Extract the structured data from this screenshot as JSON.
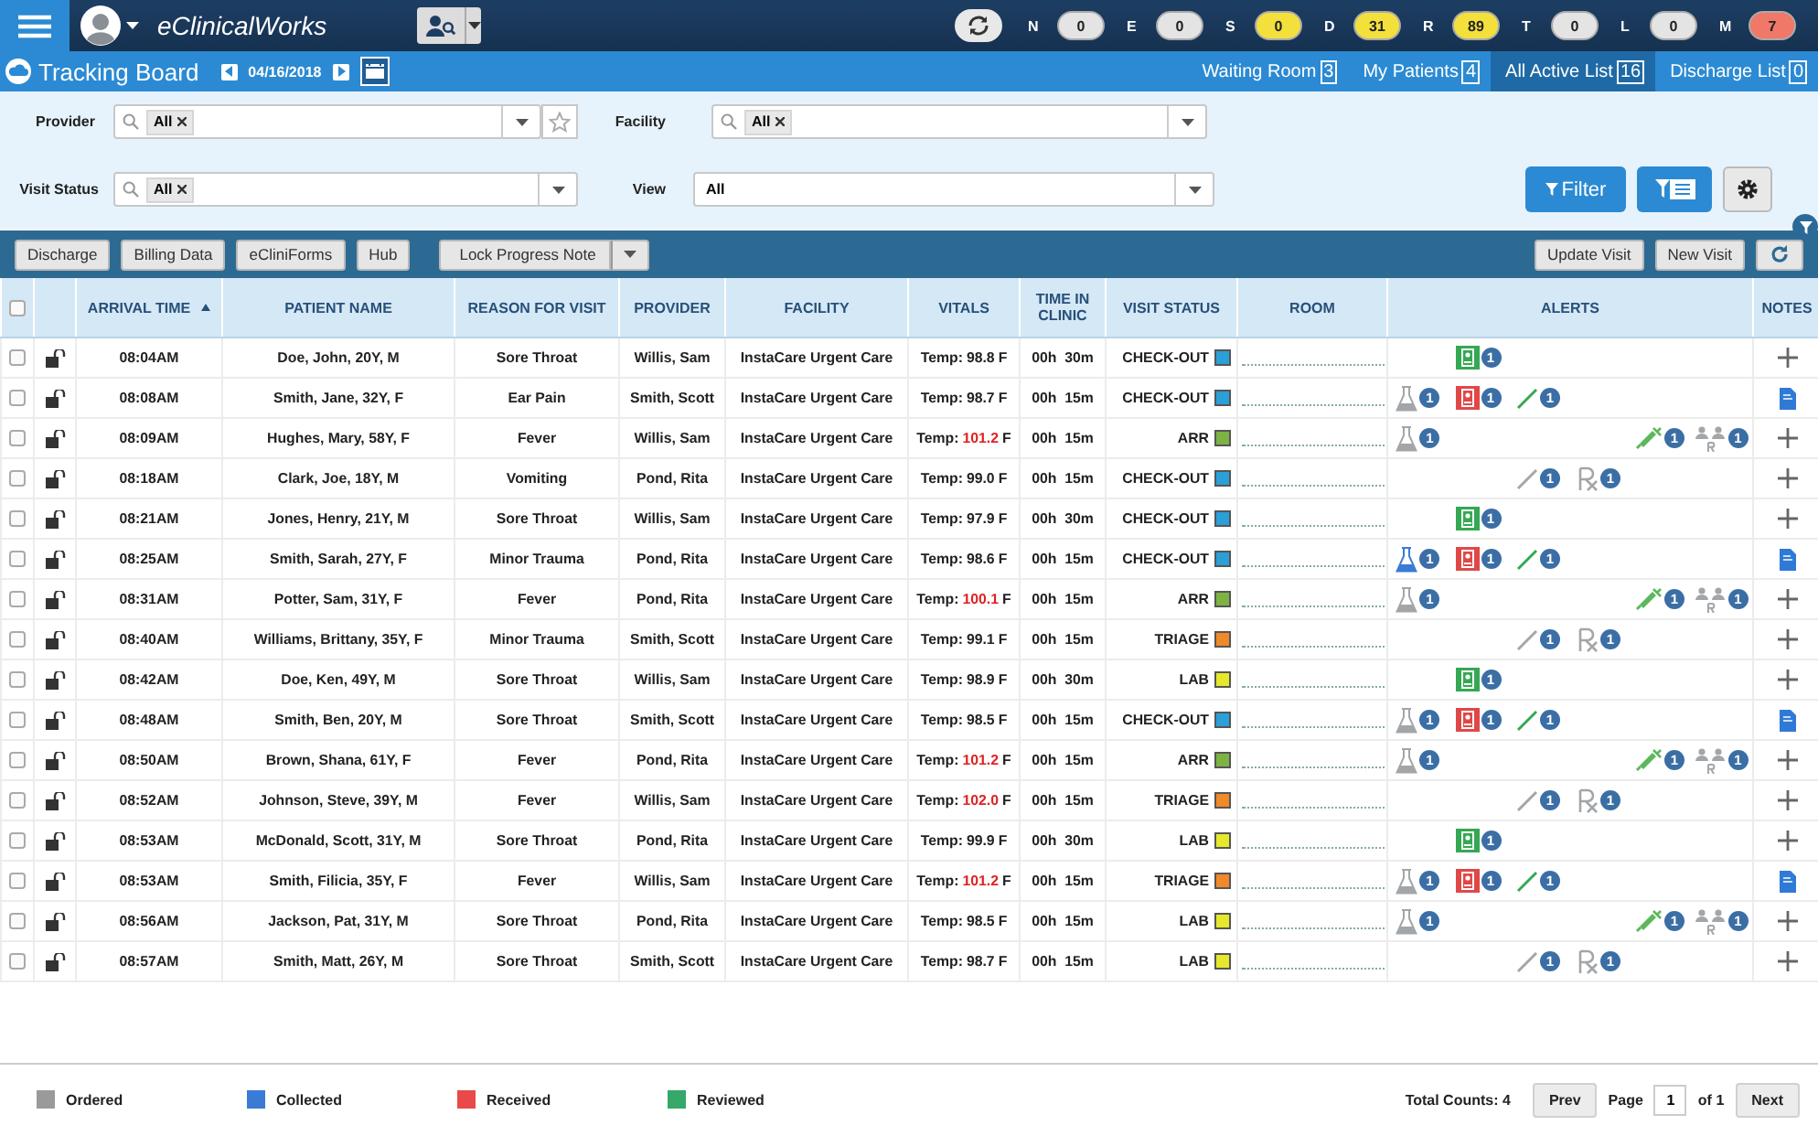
{
  "header": {
    "logo": "eClinicalWorks",
    "counters": [
      {
        "letter": "N",
        "value": "0",
        "color": "#e4e4e4"
      },
      {
        "letter": "E",
        "value": "0",
        "color": "#e4e4e4"
      },
      {
        "letter": "S",
        "value": "0",
        "color": "#f3e03c"
      },
      {
        "letter": "D",
        "value": "31",
        "color": "#f3e03c"
      },
      {
        "letter": "R",
        "value": "89",
        "color": "#f3e03c"
      },
      {
        "letter": "T",
        "value": "0",
        "color": "#e4e4e4"
      },
      {
        "letter": "L",
        "value": "0",
        "color": "#e4e4e4"
      },
      {
        "letter": "M",
        "value": "7",
        "color": "#f07868"
      }
    ]
  },
  "subbar": {
    "title": "Tracking Board",
    "date": "04/16/2018",
    "tabs": [
      {
        "label": "Waiting Room",
        "count": "3",
        "selected": false
      },
      {
        "label": "My Patients",
        "count": "4",
        "selected": false
      },
      {
        "label": "All Active List",
        "count": "16",
        "selected": true
      },
      {
        "label": "Discharge List",
        "count": "0",
        "selected": false
      }
    ]
  },
  "filters": {
    "provider": {
      "label": "Provider",
      "tags": [
        "All"
      ]
    },
    "facility": {
      "label": "Facility",
      "tags": [
        "All"
      ]
    },
    "visit_status": {
      "label": "Visit Status",
      "tags": [
        "All"
      ]
    },
    "view": {
      "label": "View",
      "value": "All"
    },
    "filter_button": "Filter"
  },
  "toolbar": {
    "left_buttons": [
      "Discharge",
      "Billing Data",
      "eCliniForms",
      "Hub"
    ],
    "split_button": "Lock Progress Note",
    "right_buttons": [
      "Update Visit",
      "New Visit"
    ]
  },
  "table": {
    "select_all_checked": false,
    "columns": [
      {
        "label": "ARRIVAL TIME",
        "sorted": true
      },
      {
        "label": "PATIENT NAME",
        "sorted": false
      },
      {
        "label": "REASON FOR VISIT",
        "sorted": false
      },
      {
        "label": "PROVIDER",
        "sorted": false
      },
      {
        "label": "FACILITY",
        "sorted": false
      },
      {
        "label": "VITALS",
        "sorted": false
      },
      {
        "label": "TIME IN CLINIC",
        "sorted": false
      },
      {
        "label": "VISIT STATUS",
        "sorted": false
      },
      {
        "label": "ROOM",
        "sorted": false
      },
      {
        "label": "ALERTS",
        "sorted": false
      },
      {
        "label": "NOTES",
        "sorted": false
      }
    ],
    "rows": [
      {
        "checked": false,
        "arrival": "08:04AM",
        "patient": "Doe, John, 20Y, M",
        "reason": "Sore Throat",
        "provider": "Willis, Sam",
        "facility": "InstaCare Urgent Care",
        "vitals": {
          "label": "Temp:",
          "value": "98.8",
          "unit": "F",
          "high": false
        },
        "time_in_clinic": "00h  30m",
        "status": {
          "text": "CHECK-OUT",
          "color": "#2a9fd8"
        },
        "alerts": [
          {
            "kind": "report",
            "color": "#35a853",
            "count": "1"
          }
        ],
        "note": {
          "kind": "add"
        }
      },
      {
        "checked": false,
        "arrival": "08:08AM",
        "patient": "Smith, Jane, 32Y, F",
        "reason": "Ear Pain",
        "provider": "Smith, Scott",
        "facility": "InstaCare Urgent Care",
        "vitals": {
          "label": "Temp:",
          "value": "98.7",
          "unit": "F",
          "high": false
        },
        "time_in_clinic": "00h  15m",
        "status": {
          "text": "CHECK-OUT",
          "color": "#2a9fd8"
        },
        "alerts": [
          {
            "kind": "lab",
            "color": "#a3a6a9",
            "count": "1"
          },
          {
            "kind": "report",
            "color": "#e04848",
            "count": "1"
          },
          {
            "kind": "procedure",
            "color": "#35a853",
            "count": "1"
          }
        ],
        "note": {
          "kind": "document"
        }
      },
      {
        "checked": false,
        "arrival": "08:09AM",
        "patient": "Hughes, Mary, 58Y, F",
        "reason": "Fever",
        "provider": "Willis, Sam",
        "facility": "InstaCare Urgent Care",
        "vitals": {
          "label": "Temp:",
          "value": "101.2",
          "unit": "F",
          "high": true
        },
        "time_in_clinic": "00h  15m",
        "status": {
          "text": "ARR",
          "color": "#7cb342"
        },
        "alerts": [
          {
            "kind": "lab",
            "color": "#a3a6a9",
            "count": "1"
          },
          {
            "kind": "injection",
            "color": "#5cb85c",
            "count": "1"
          },
          {
            "kind": "referral",
            "color": "#a3a6a9",
            "count": "1"
          }
        ],
        "note": {
          "kind": "add"
        }
      },
      {
        "checked": false,
        "arrival": "08:18AM",
        "patient": "Clark, Joe, 18Y, M",
        "reason": "Vomiting",
        "provider": "Pond, Rita",
        "facility": "InstaCare Urgent Care",
        "vitals": {
          "label": "Temp:",
          "value": "99.0",
          "unit": "F",
          "high": false
        },
        "time_in_clinic": "00h  15m",
        "status": {
          "text": "CHECK-OUT",
          "color": "#2a9fd8"
        },
        "alerts": [
          {
            "kind": "procedure",
            "color": "#a3a6a9",
            "count": "1"
          },
          {
            "kind": "rx",
            "color": "#a3a6a9",
            "count": "1"
          }
        ],
        "note": {
          "kind": "add"
        }
      },
      {
        "checked": false,
        "arrival": "08:21AM",
        "patient": "Jones, Henry, 21Y, M",
        "reason": "Sore Throat",
        "provider": "Willis, Sam",
        "facility": "InstaCare Urgent Care",
        "vitals": {
          "label": "Temp:",
          "value": "97.9",
          "unit": "F",
          "high": false
        },
        "time_in_clinic": "00h  30m",
        "status": {
          "text": "CHECK-OUT",
          "color": "#2a9fd8"
        },
        "alerts": [
          {
            "kind": "report",
            "color": "#35a853",
            "count": "1"
          }
        ],
        "note": {
          "kind": "add"
        }
      },
      {
        "checked": false,
        "arrival": "08:25AM",
        "patient": "Smith, Sarah, 27Y, F",
        "reason": "Minor Trauma",
        "provider": "Pond, Rita",
        "facility": "InstaCare Urgent Care",
        "vitals": {
          "label": "Temp:",
          "value": "98.6",
          "unit": "F",
          "high": false
        },
        "time_in_clinic": "00h  15m",
        "status": {
          "text": "CHECK-OUT",
          "color": "#2a9fd8"
        },
        "alerts": [
          {
            "kind": "lab",
            "color": "#3a7bd5",
            "count": "1"
          },
          {
            "kind": "report",
            "color": "#e04848",
            "count": "1"
          },
          {
            "kind": "procedure",
            "color": "#35a853",
            "count": "1"
          }
        ],
        "note": {
          "kind": "document"
        }
      },
      {
        "checked": false,
        "arrival": "08:31AM",
        "patient": "Potter, Sam, 31Y, F",
        "reason": "Fever",
        "provider": "Pond, Rita",
        "facility": "InstaCare Urgent Care",
        "vitals": {
          "label": "Temp:",
          "value": "100.1",
          "unit": "F",
          "high": true
        },
        "time_in_clinic": "00h  15m",
        "status": {
          "text": "ARR",
          "color": "#7cb342"
        },
        "alerts": [
          {
            "kind": "lab",
            "color": "#a3a6a9",
            "count": "1"
          },
          {
            "kind": "injection",
            "color": "#5cb85c",
            "count": "1"
          },
          {
            "kind": "referral",
            "color": "#a3a6a9",
            "count": "1"
          }
        ],
        "note": {
          "kind": "add"
        }
      },
      {
        "checked": false,
        "arrival": "08:40AM",
        "patient": "Williams, Brittany, 35Y, F",
        "reason": "Minor Trauma",
        "provider": "Smith, Scott",
        "facility": "InstaCare Urgent Care",
        "vitals": {
          "label": "Temp:",
          "value": "99.1",
          "unit": "F",
          "high": false
        },
        "time_in_clinic": "00h  15m",
        "status": {
          "text": "TRIAGE",
          "color": "#f0892a"
        },
        "alerts": [
          {
            "kind": "procedure",
            "color": "#a3a6a9",
            "count": "1"
          },
          {
            "kind": "rx",
            "color": "#a3a6a9",
            "count": "1"
          }
        ],
        "note": {
          "kind": "add"
        }
      },
      {
        "checked": false,
        "arrival": "08:42AM",
        "patient": "Doe, Ken, 49Y, M",
        "reason": "Sore Throat",
        "provider": "Willis, Sam",
        "facility": "InstaCare Urgent Care",
        "vitals": {
          "label": "Temp:",
          "value": "98.9",
          "unit": "F",
          "high": false
        },
        "time_in_clinic": "00h  30m",
        "status": {
          "text": "LAB",
          "color": "#e6e82c"
        },
        "alerts": [
          {
            "kind": "report",
            "color": "#35a853",
            "count": "1"
          }
        ],
        "note": {
          "kind": "add"
        }
      },
      {
        "checked": false,
        "arrival": "08:48AM",
        "patient": "Smith, Ben, 20Y, M",
        "reason": "Sore Throat",
        "provider": "Smith, Scott",
        "facility": "InstaCare Urgent Care",
        "vitals": {
          "label": "Temp:",
          "value": "98.5",
          "unit": "F",
          "high": false
        },
        "time_in_clinic": "00h  15m",
        "status": {
          "text": "CHECK-OUT",
          "color": "#2a9fd8"
        },
        "alerts": [
          {
            "kind": "lab",
            "color": "#a3a6a9",
            "count": "1"
          },
          {
            "kind": "report",
            "color": "#e04848",
            "count": "1"
          },
          {
            "kind": "procedure",
            "color": "#35a853",
            "count": "1"
          }
        ],
        "note": {
          "kind": "document"
        }
      },
      {
        "checked": false,
        "arrival": "08:50AM",
        "patient": "Brown, Shana, 61Y, F",
        "reason": "Fever",
        "provider": "Pond, Rita",
        "facility": "InstaCare Urgent Care",
        "vitals": {
          "label": "Temp:",
          "value": "101.2",
          "unit": "F",
          "high": true
        },
        "time_in_clinic": "00h  15m",
        "status": {
          "text": "ARR",
          "color": "#7cb342"
        },
        "alerts": [
          {
            "kind": "lab",
            "color": "#a3a6a9",
            "count": "1"
          },
          {
            "kind": "injection",
            "color": "#5cb85c",
            "count": "1"
          },
          {
            "kind": "referral",
            "color": "#a3a6a9",
            "count": "1"
          }
        ],
        "note": {
          "kind": "add"
        }
      },
      {
        "checked": false,
        "arrival": "08:52AM",
        "patient": "Johnson, Steve, 39Y, M",
        "reason": "Fever",
        "provider": "Willis, Sam",
        "facility": "InstaCare Urgent Care",
        "vitals": {
          "label": "Temp:",
          "value": "102.0",
          "unit": "F",
          "high": true
        },
        "time_in_clinic": "00h  15m",
        "status": {
          "text": "TRIAGE",
          "color": "#f0892a"
        },
        "alerts": [
          {
            "kind": "procedure",
            "color": "#a3a6a9",
            "count": "1"
          },
          {
            "kind": "rx",
            "color": "#a3a6a9",
            "count": "1"
          }
        ],
        "note": {
          "kind": "add"
        }
      },
      {
        "checked": false,
        "arrival": "08:53AM",
        "patient": "McDonald, Scott, 31Y, M",
        "reason": "Sore Throat",
        "provider": "Pond, Rita",
        "facility": "InstaCare Urgent Care",
        "vitals": {
          "label": "Temp:",
          "value": "99.9",
          "unit": "F",
          "high": false
        },
        "time_in_clinic": "00h  30m",
        "status": {
          "text": "LAB",
          "color": "#e6e82c"
        },
        "alerts": [
          {
            "kind": "report",
            "color": "#35a853",
            "count": "1"
          }
        ],
        "note": {
          "kind": "add"
        }
      },
      {
        "checked": false,
        "arrival": "08:53AM",
        "patient": "Smith, Filicia, 35Y, F",
        "reason": "Fever",
        "provider": "Willis, Sam",
        "facility": "InstaCare Urgent Care",
        "vitals": {
          "label": "Temp:",
          "value": "101.2",
          "unit": "F",
          "high": true
        },
        "time_in_clinic": "00h  15m",
        "status": {
          "text": "TRIAGE",
          "color": "#f0892a"
        },
        "alerts": [
          {
            "kind": "lab",
            "color": "#a3a6a9",
            "count": "1"
          },
          {
            "kind": "report",
            "color": "#e04848",
            "count": "1"
          },
          {
            "kind": "procedure",
            "color": "#35a853",
            "count": "1"
          }
        ],
        "note": {
          "kind": "document"
        }
      },
      {
        "checked": false,
        "arrival": "08:56AM",
        "patient": "Jackson, Pat, 31Y, M",
        "reason": "Sore Throat",
        "provider": "Pond, Rita",
        "facility": "InstaCare Urgent Care",
        "vitals": {
          "label": "Temp:",
          "value": "98.5",
          "unit": "F",
          "high": false
        },
        "time_in_clinic": "00h  15m",
        "status": {
          "text": "LAB",
          "color": "#e6e82c"
        },
        "alerts": [
          {
            "kind": "lab",
            "color": "#a3a6a9",
            "count": "1"
          },
          {
            "kind": "injection",
            "color": "#5cb85c",
            "count": "1"
          },
          {
            "kind": "referral",
            "color": "#a3a6a9",
            "count": "1"
          }
        ],
        "note": {
          "kind": "add"
        }
      },
      {
        "checked": false,
        "arrival": "08:57AM",
        "patient": "Smith, Matt, 26Y, M",
        "reason": "Sore Throat",
        "provider": "Smith, Scott",
        "facility": "InstaCare Urgent Care",
        "vitals": {
          "label": "Temp:",
          "value": "98.7",
          "unit": "F",
          "high": false
        },
        "time_in_clinic": "00h  15m",
        "status": {
          "text": "LAB",
          "color": "#e6e82c"
        },
        "alerts": [
          {
            "kind": "procedure",
            "color": "#a3a6a9",
            "count": "1"
          },
          {
            "kind": "rx",
            "color": "#a3a6a9",
            "count": "1"
          }
        ],
        "note": {
          "kind": "add"
        }
      }
    ]
  },
  "legend": [
    {
      "label": "Ordered",
      "color": "#9a9a9a"
    },
    {
      "label": "Collected",
      "color": "#3a7bd5"
    },
    {
      "label": "Received",
      "color": "#e84a4a"
    },
    {
      "label": "Reviewed",
      "color": "#35a86a"
    }
  ],
  "pager": {
    "total": "Total Counts: 4",
    "prev": "Prev",
    "page_label": "Page",
    "page": "1",
    "of": "of 1",
    "next": "Next"
  }
}
